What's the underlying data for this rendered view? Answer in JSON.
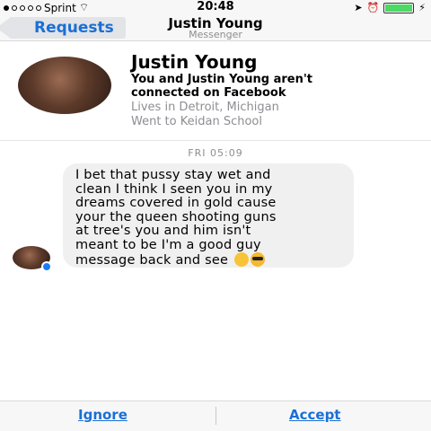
{
  "status_bar": {
    "carrier": "Sprint",
    "time": "20:48",
    "battery_color": "#4cd964"
  },
  "nav": {
    "back_label": "Requests",
    "title": "Justin Young",
    "subtitle": "Messenger"
  },
  "profile": {
    "name": "Justin Young",
    "connection_line1": "You and Justin Young aren't",
    "connection_line2": "connected on Facebook",
    "location": "Lives in Detroit, Michigan",
    "education": "Went to Keidan School"
  },
  "conversation": {
    "timestamp": "FRI 05:09",
    "message_lines": [
      "I bet that pussy stay wet and",
      "clean I think I seen you in my",
      "dreams covered in gold cause",
      "your the queen shooting guns",
      "at tree's you and him isn't",
      "meant to be I'm a good guy",
      "message back and see"
    ],
    "emojis": [
      "kissing-face-emoji",
      "sunglasses-face-emoji"
    ]
  },
  "actions": {
    "ignore_label": "Ignore",
    "accept_label": "Accept"
  },
  "colors": {
    "accent": "#1a6fd6",
    "messenger_badge": "#1a7cf3",
    "bubble": "#f1f0f0"
  }
}
